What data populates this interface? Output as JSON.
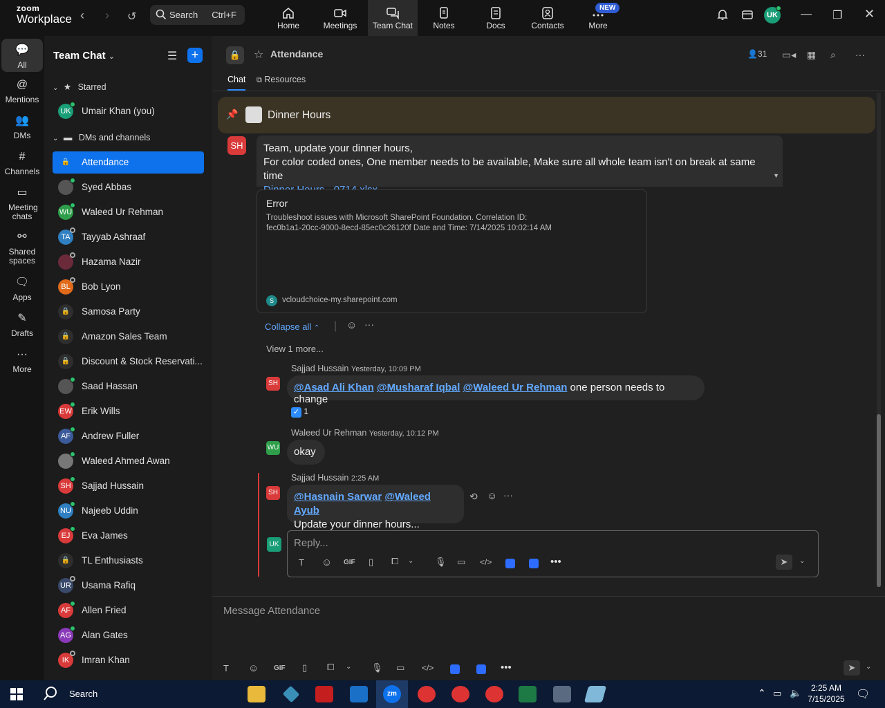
{
  "app": {
    "logo_top": "zoom",
    "logo_bottom": "Workplace"
  },
  "search": {
    "label": "Search",
    "shortcut": "Ctrl+F"
  },
  "nav_tabs": [
    {
      "label": "Home",
      "icon": "home-icon"
    },
    {
      "label": "Meetings",
      "icon": "video-icon"
    },
    {
      "label": "Team Chat",
      "icon": "chat-icon"
    },
    {
      "label": "Notes",
      "icon": "notes-icon"
    },
    {
      "label": "Docs",
      "icon": "docs-icon"
    },
    {
      "label": "Contacts",
      "icon": "contacts-icon"
    },
    {
      "label": "More",
      "icon": "more-icon"
    }
  ],
  "new_badge": "NEW",
  "user_initials": "UK",
  "rail": [
    {
      "label": "All",
      "icon": "chat-icon"
    },
    {
      "label": "Mentions",
      "icon": "at-icon"
    },
    {
      "label": "DMs",
      "icon": "people-icon"
    },
    {
      "label": "Channels",
      "icon": "hash-icon"
    },
    {
      "label": "Meeting chats",
      "icon": "calendar-icon"
    },
    {
      "label": "Shared spaces",
      "icon": "share-icon"
    },
    {
      "label": "Apps",
      "icon": "apps-icon"
    },
    {
      "label": "Drafts",
      "icon": "drafts-icon"
    },
    {
      "label": "More",
      "icon": "more-icon"
    }
  ],
  "sidebar": {
    "title": "Team Chat",
    "starred_label": "Starred",
    "starred_item": {
      "label": "Umair Khan (you)",
      "initials": "UK",
      "color": "#1a9e77"
    },
    "dms_label": "DMs and channels",
    "items": [
      {
        "label": "Attendance",
        "initials": "",
        "color": "#0e72ed",
        "type": "lock"
      },
      {
        "label": "Syed Abbas",
        "initials": "",
        "color": "#555555",
        "type": "photo"
      },
      {
        "label": "Waleed Ur Rehman",
        "initials": "WU",
        "color": "#2e9e4a",
        "type": "initials"
      },
      {
        "label": "Tayyab Ashraaf",
        "initials": "TA",
        "color": "#2f7fc1",
        "type": "initials"
      },
      {
        "label": "Hazama Nazir",
        "initials": "",
        "color": "#6a2a3a",
        "type": "photo"
      },
      {
        "label": "Bob Lyon",
        "initials": "BL",
        "color": "#e06a1a",
        "type": "initials"
      },
      {
        "label": "Samosa Party",
        "initials": "",
        "color": "#2e2e2e",
        "type": "lock"
      },
      {
        "label": "Amazon Sales Team",
        "initials": "",
        "color": "#2e2e2e",
        "type": "lock"
      },
      {
        "label": "Discount & Stock Reservati...",
        "initials": "",
        "color": "#2e2e2e",
        "type": "lock"
      },
      {
        "label": "Saad Hassan",
        "initials": "",
        "color": "#555555",
        "type": "photo"
      },
      {
        "label": "Erik Wills",
        "initials": "EW",
        "color": "#d93a3a",
        "type": "initials"
      },
      {
        "label": "Andrew Fuller",
        "initials": "AF",
        "color": "#3a5a9a",
        "type": "initials"
      },
      {
        "label": "Waleed Ahmed Awan",
        "initials": "",
        "color": "#777777",
        "type": "photo"
      },
      {
        "label": "Sajjad Hussain",
        "initials": "SH",
        "color": "#d93a3a",
        "type": "initials"
      },
      {
        "label": "Najeeb Uddin",
        "initials": "NU",
        "color": "#2f7fc1",
        "type": "initials"
      },
      {
        "label": "Eva James",
        "initials": "EJ",
        "color": "#d93a3a",
        "type": "initials"
      },
      {
        "label": "TL Enthusiasts",
        "initials": "",
        "color": "#2e2e2e",
        "type": "lock"
      },
      {
        "label": "Usama Rafiq",
        "initials": "UR",
        "color": "#3a4a6a",
        "type": "initials"
      },
      {
        "label": "Allen Fried",
        "initials": "AF",
        "color": "#d93a3a",
        "type": "initials"
      },
      {
        "label": "Alan Gates",
        "initials": "AG",
        "color": "#8a3ab9",
        "type": "initials"
      },
      {
        "label": "Imran Khan",
        "initials": "IK",
        "color": "#d93a3a",
        "type": "initials"
      }
    ]
  },
  "channel": {
    "title": "Attendance",
    "member_count": "31",
    "tabs": [
      "Chat",
      "Resources"
    ],
    "pinned": "Dinner Hours"
  },
  "messages": {
    "first": {
      "initials": "SH",
      "line1": "Team, update your dinner hours,",
      "line2": "For color coded ones, One member needs to be available, Make sure all whole team isn't on break at same time",
      "link": "Dinner Hours - 0714.xlsx"
    },
    "card": {
      "title": "Error",
      "body1": "Troubleshoot issues with Microsoft SharePoint Foundation. Correlation ID:",
      "body2": "fec0b1a1-20cc-9000-8ecd-85ec0c26120f Date and Time: 7/14/2025 10:02:14 AM",
      "source": "vcloudchoice-my.sharepoint.com"
    },
    "collapse": "Collapse all",
    "view_more": "View 1 more...",
    "replies": [
      {
        "author": "Sajjad Hussain",
        "time": "Yesterday, 10:09 PM",
        "initials": "SH",
        "mentions": [
          "@Asad Ali Khan",
          "@Musharaf Iqbal",
          "@Waleed Ur Rehman"
        ],
        "text": "one person needs to change",
        "reaction_count": "1"
      },
      {
        "author": "Waleed Ur Rehman",
        "time": "Yesterday, 10:12 PM",
        "initials": "WU",
        "text": "okay"
      },
      {
        "author": "Sajjad Hussain",
        "time": "2:25 AM",
        "initials": "SH",
        "mentions": [
          "@Hasnain Sarwar",
          "@Waleed Ayub"
        ],
        "text": "Update your dinner hours..."
      }
    ],
    "reply_placeholder": "Reply...",
    "reply_avatar": "UK"
  },
  "composer": {
    "placeholder": "Message Attendance"
  },
  "taskbar": {
    "search": "Search",
    "time": "2:25 AM",
    "date": "7/15/2025"
  }
}
